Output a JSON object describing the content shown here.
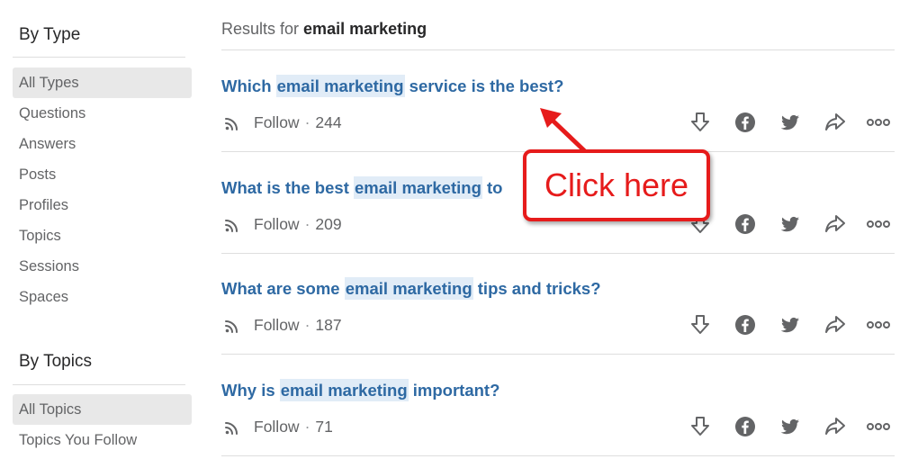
{
  "sidebar": {
    "by_type": {
      "heading": "By Type",
      "items": [
        {
          "label": "All Types",
          "active": true
        },
        {
          "label": "Questions",
          "active": false
        },
        {
          "label": "Answers",
          "active": false
        },
        {
          "label": "Posts",
          "active": false
        },
        {
          "label": "Profiles",
          "active": false
        },
        {
          "label": "Topics",
          "active": false
        },
        {
          "label": "Sessions",
          "active": false
        },
        {
          "label": "Spaces",
          "active": false
        }
      ]
    },
    "by_topics": {
      "heading": "By Topics",
      "items": [
        {
          "label": "All Topics",
          "active": true
        },
        {
          "label": "Topics You Follow",
          "active": false
        }
      ]
    }
  },
  "main": {
    "results_prefix": "Results for",
    "query": "email marketing",
    "results": [
      {
        "pre": "Which ",
        "highlight": "email marketing",
        "post": " service is the best?",
        "follow_label": "Follow",
        "separator": "·",
        "follow_count": "244"
      },
      {
        "pre": "What is the best ",
        "highlight": "email marketing",
        "post": " to",
        "follow_label": "Follow",
        "separator": "·",
        "follow_count": "209"
      },
      {
        "pre": "What are some ",
        "highlight": "email marketing",
        "post": " tips and tricks?",
        "follow_label": "Follow",
        "separator": "·",
        "follow_count": "187"
      },
      {
        "pre": "Why is ",
        "highlight": "email marketing",
        "post": " important?",
        "follow_label": "Follow",
        "separator": "·",
        "follow_count": "71"
      }
    ],
    "action_icons": [
      "downvote-icon",
      "facebook-icon",
      "twitter-icon",
      "share-icon",
      "more-icon"
    ]
  },
  "annotation": {
    "callout_text": "Click here",
    "color": "#e61b1b"
  },
  "colors": {
    "link": "#2e69a3",
    "highlight_bg": "#e1ecf7",
    "muted_text": "#636466",
    "icon": "#636466",
    "active_bg": "#e8e8e8"
  }
}
